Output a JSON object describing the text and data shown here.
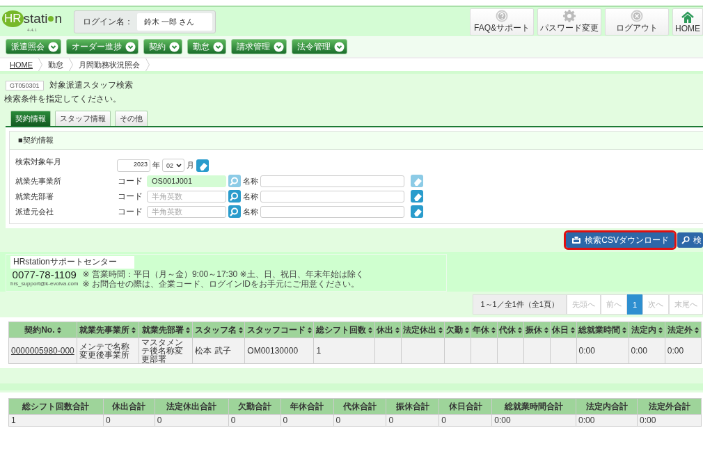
{
  "header": {
    "logo": {
      "brand_a": "HR",
      "brand_b": "stati",
      "brand_c": "n",
      "version": "4.4.1"
    },
    "login_label": "ログイン名：",
    "login_name": "鈴木 一郎 さん",
    "buttons": [
      {
        "kind": "help",
        "label": "FAQ&サポート"
      },
      {
        "kind": "gear",
        "label": "パスワード変更"
      },
      {
        "kind": "close",
        "label": "ログアウト"
      },
      {
        "kind": "home",
        "label": "HOME"
      }
    ]
  },
  "menu": [
    "派遣照会",
    "オーダー進捗",
    "契約",
    "勤怠",
    "請求管理",
    "法令管理"
  ],
  "breadcrumb": [
    {
      "label": "HOME",
      "link": true
    },
    {
      "label": "勤怠",
      "link": false
    },
    {
      "label": "月間勤務状況照会",
      "link": false
    }
  ],
  "page": {
    "code": "GT050301",
    "title": "対象派遣スタッフ検索",
    "instruction": "検索条件を指定してください。"
  },
  "tabs": [
    {
      "label": "契約情報",
      "selected": true
    },
    {
      "label": "スタッフ情報",
      "selected": false
    },
    {
      "label": "その他",
      "selected": false
    }
  ],
  "panel": {
    "title": "■契約情報",
    "rows": [
      {
        "kind": "yearmonth",
        "label": "検索対象年月",
        "year": "2023",
        "year_unit": "年",
        "month": "02",
        "month_unit": "月"
      },
      {
        "kind": "lookup",
        "label": "就業先事業所",
        "code_label": "コード",
        "code_value": "OS001J001",
        "locked": true,
        "name_label": "名称"
      },
      {
        "kind": "lookup",
        "label": "就業先部署",
        "code_label": "コード",
        "placeholder": "半角英数",
        "locked": false,
        "name_label": "名称"
      },
      {
        "kind": "lookup",
        "label": "派遣元会社",
        "code_label": "コード",
        "placeholder": "半角英数",
        "locked": false,
        "name_label": "名称"
      }
    ]
  },
  "actions": [
    {
      "kind": "csv",
      "label": "検索CSVダウンロード",
      "focused": true
    },
    {
      "kind": "search",
      "label": "検",
      "focused": false
    }
  ],
  "support": {
    "title": "HRstationサポートセンター",
    "phone": "0077-78-1109",
    "email": "hrs_support@k-evolva.com",
    "notes": [
      "※ 営業時間：平日（月～金）9:00～17:30 ※土、日、祝日、年末年始は除く",
      "※ お問合せの際は、企業コード、ログインIDをお手元にご用意ください。"
    ]
  },
  "pagination": {
    "info": "1～1／全1件（全1頁）",
    "pages": [
      {
        "label": "先頭へ",
        "selected": false,
        "disabled": true
      },
      {
        "label": "前へ",
        "selected": false,
        "disabled": true
      },
      {
        "label": "1",
        "selected": true,
        "disabled": false
      },
      {
        "label": "次へ",
        "selected": false,
        "disabled": true
      },
      {
        "label": "末尾へ",
        "selected": false,
        "disabled": true
      }
    ]
  },
  "results": {
    "columns": [
      "契約No.",
      "就業先事業所",
      "就業先部署",
      "スタッフ名",
      "スタッフコード",
      "総シフト回数",
      "休出",
      "法定休出",
      "欠勤",
      "年休",
      "代休",
      "振休",
      "休日",
      "総就業時間",
      "法定内",
      "法定外"
    ],
    "rows": [
      [
        "0000005980-000",
        "メンテで名称変更後事業所",
        "マスタメンテ後名称変更部署",
        "松本 武子",
        "OM00130000",
        "1",
        "",
        "",
        "",
        "",
        "",
        "",
        "",
        "0:00",
        "0:00",
        "0:00"
      ]
    ]
  },
  "totals": {
    "columns": [
      "総シフト回数合計",
      "休出合計",
      "法定休出合計",
      "欠勤合計",
      "年休合計",
      "代休合計",
      "振休合計",
      "休日合計",
      "総就業時間合計",
      "法定内合計",
      "法定外合計"
    ],
    "rows": [
      [
        "1",
        "0",
        "0",
        "0",
        "0",
        "0",
        "0",
        "0",
        "0:00",
        "0:00",
        "0:00"
      ]
    ]
  }
}
